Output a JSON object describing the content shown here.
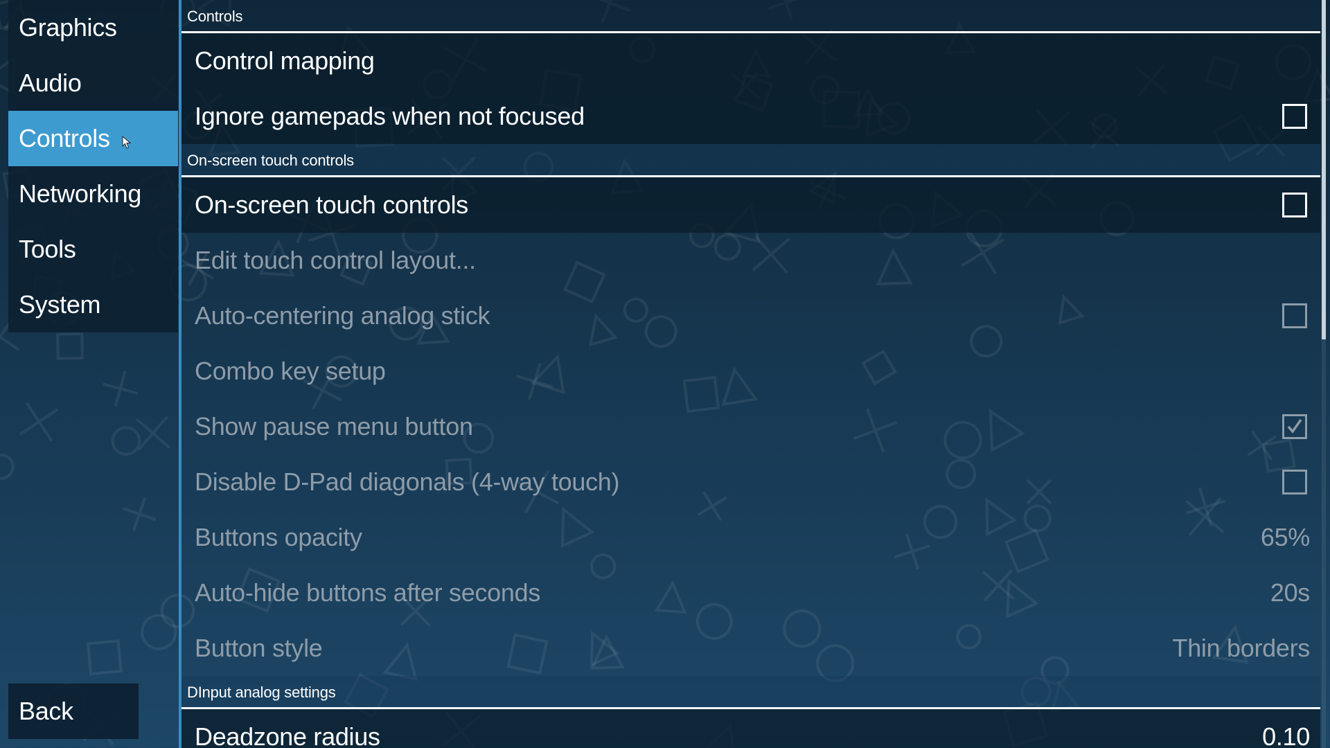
{
  "sidebar": {
    "items": [
      {
        "label": "Graphics",
        "active": false
      },
      {
        "label": "Audio",
        "active": false
      },
      {
        "label": "Controls",
        "active": true
      },
      {
        "label": "Networking",
        "active": false
      },
      {
        "label": "Tools",
        "active": false
      },
      {
        "label": "System",
        "active": false
      }
    ],
    "back_label": "Back"
  },
  "sections": [
    {
      "header": "Controls",
      "rows": [
        {
          "label": "Control mapping",
          "type": "link",
          "enabled": true
        },
        {
          "label": "Ignore gamepads when not focused",
          "type": "checkbox",
          "checked": false,
          "enabled": true
        }
      ]
    },
    {
      "header": "On-screen touch controls",
      "rows": [
        {
          "label": "On-screen touch controls",
          "type": "checkbox",
          "checked": false,
          "enabled": true
        },
        {
          "label": "Edit touch control layout...",
          "type": "link",
          "enabled": false
        },
        {
          "label": "Auto-centering analog stick",
          "type": "checkbox",
          "checked": false,
          "enabled": false
        },
        {
          "label": "Combo key setup",
          "type": "link",
          "enabled": false
        },
        {
          "label": "Show pause menu button",
          "type": "checkbox",
          "checked": true,
          "enabled": false
        },
        {
          "label": "Disable D-Pad diagonals (4-way touch)",
          "type": "checkbox",
          "checked": false,
          "enabled": false
        },
        {
          "label": "Buttons opacity",
          "type": "value",
          "value": "65%",
          "enabled": false
        },
        {
          "label": "Auto-hide buttons after seconds",
          "type": "value",
          "value": "20s",
          "enabled": false
        },
        {
          "label": "Button style",
          "type": "value",
          "value": "Thin borders",
          "enabled": false
        }
      ]
    },
    {
      "header": "DInput analog settings",
      "rows": [
        {
          "label": "Deadzone radius",
          "type": "value",
          "value": "0.10",
          "enabled": true
        }
      ]
    }
  ],
  "colors": {
    "accent": "#3e9bd0",
    "disabled_text": "#8e9ca8",
    "background_top": "#0f2739",
    "background_bottom": "#1d4767"
  },
  "icons": {
    "cursor": "mouse-pointer-icon",
    "checkbox_checked": "checkmark-icon",
    "background_symbols": [
      "circle-icon",
      "cross-icon",
      "square-icon",
      "triangle-icon"
    ]
  }
}
